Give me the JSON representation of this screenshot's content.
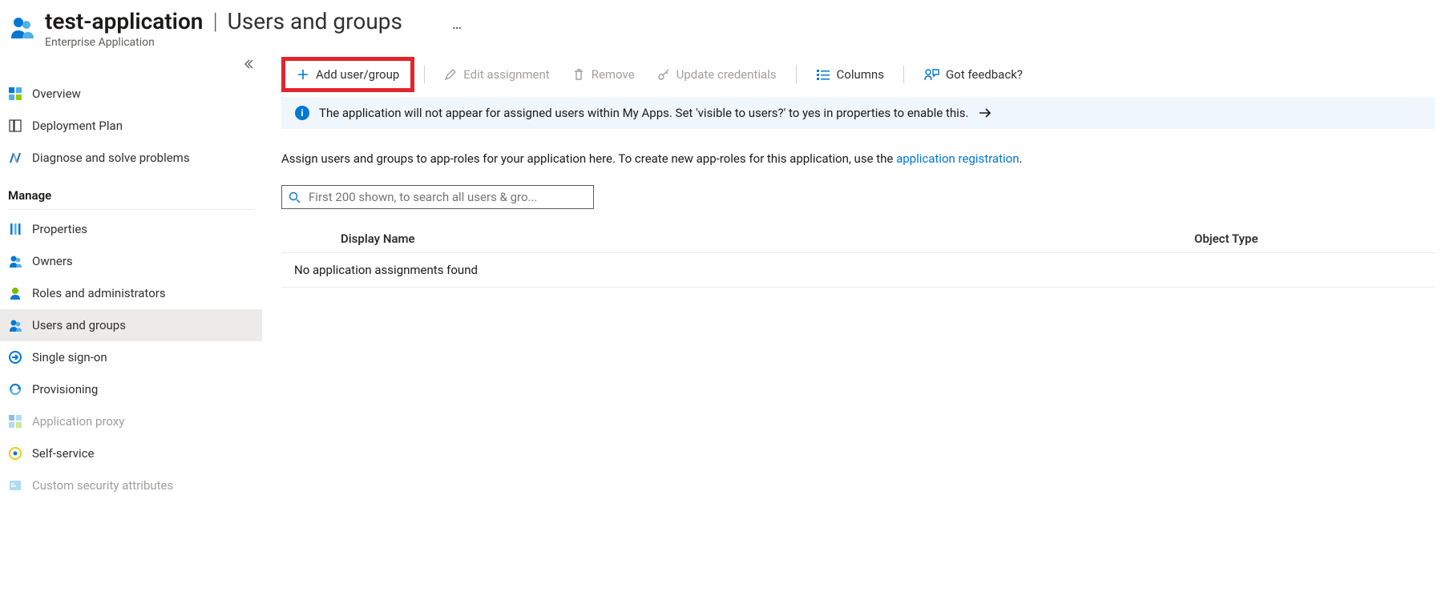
{
  "header": {
    "app_name": "test-application",
    "separator": "|",
    "page_title": "Users and groups",
    "subtitle": "Enterprise Application",
    "more": "…"
  },
  "sidebar": {
    "items_top": [
      {
        "id": "overview",
        "label": "Overview"
      },
      {
        "id": "deployment-plan",
        "label": "Deployment Plan"
      },
      {
        "id": "diagnose",
        "label": "Diagnose and solve problems"
      }
    ],
    "section_manage": "Manage",
    "items_manage": [
      {
        "id": "properties",
        "label": "Properties"
      },
      {
        "id": "owners",
        "label": "Owners"
      },
      {
        "id": "roles",
        "label": "Roles and administrators"
      },
      {
        "id": "users-groups",
        "label": "Users and groups",
        "selected": true
      },
      {
        "id": "sso",
        "label": "Single sign-on"
      },
      {
        "id": "provisioning",
        "label": "Provisioning"
      },
      {
        "id": "app-proxy",
        "label": "Application proxy",
        "disabled": true
      },
      {
        "id": "self-service",
        "label": "Self-service"
      },
      {
        "id": "custom-sec",
        "label": "Custom security attributes",
        "disabled": true
      }
    ]
  },
  "toolbar": {
    "add": "Add user/group",
    "edit": "Edit assignment",
    "remove": "Remove",
    "update": "Update credentials",
    "columns": "Columns",
    "feedback": "Got feedback?"
  },
  "banner": {
    "text": "The application will not appear for assigned users within My Apps. Set 'visible to users?' to yes in properties to enable this."
  },
  "description": {
    "prefix": "Assign users and groups to app-roles for your application here. To create new app-roles for this application, use the ",
    "link": "application registration",
    "suffix": "."
  },
  "search": {
    "placeholder": "First 200 shown, to search all users & gro..."
  },
  "table": {
    "col_name": "Display Name",
    "col_type": "Object Type",
    "empty": "No application assignments found"
  }
}
